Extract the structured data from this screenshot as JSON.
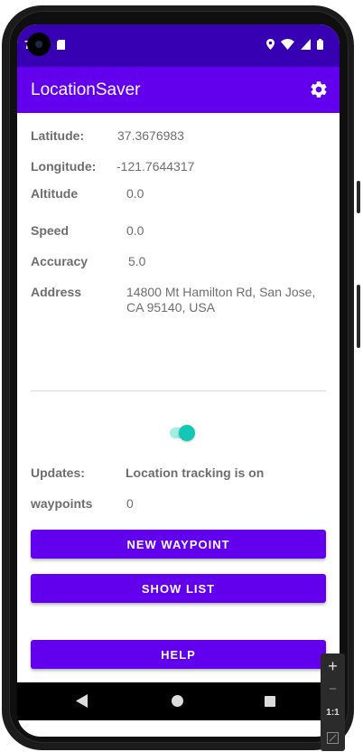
{
  "status_bar": {
    "clock": "7"
  },
  "app_bar": {
    "title": "LocationSaver",
    "settings_icon": "gear-icon"
  },
  "fields": {
    "latitude": {
      "label": "Latitude:",
      "value": "37.3676983"
    },
    "longitude": {
      "label": "Longitude:",
      "value": "-121.7644317"
    },
    "altitude": {
      "label": "Altitude",
      "value": "0.0"
    },
    "speed": {
      "label": "Speed",
      "value": "0.0"
    },
    "accuracy": {
      "label": "Accuracy",
      "value": "5.0"
    },
    "address": {
      "label": "Address",
      "value_line1": "14800 Mt Hamilton Rd, San Jose,",
      "value_line2": "CA 95140, USA"
    }
  },
  "tracking": {
    "switch_on": true,
    "updates_label": "Updates:",
    "updates_value": "Location tracking is on",
    "waypoints_label": "waypoints",
    "waypoints_value": "0"
  },
  "buttons": {
    "new_waypoint": "NEW WAYPOINT",
    "show_list": "SHOW LIST",
    "help": "HELP"
  },
  "emulator_panel": {
    "zoom_in": "+",
    "zoom_out": "−",
    "one_to_one": "1:1"
  },
  "colors": {
    "status_bar": "#3700b3",
    "app_bar": "#6200ee",
    "button": "#6200ee",
    "switch_thumb": "#12c8b5",
    "switch_track": "#a5ece4"
  }
}
